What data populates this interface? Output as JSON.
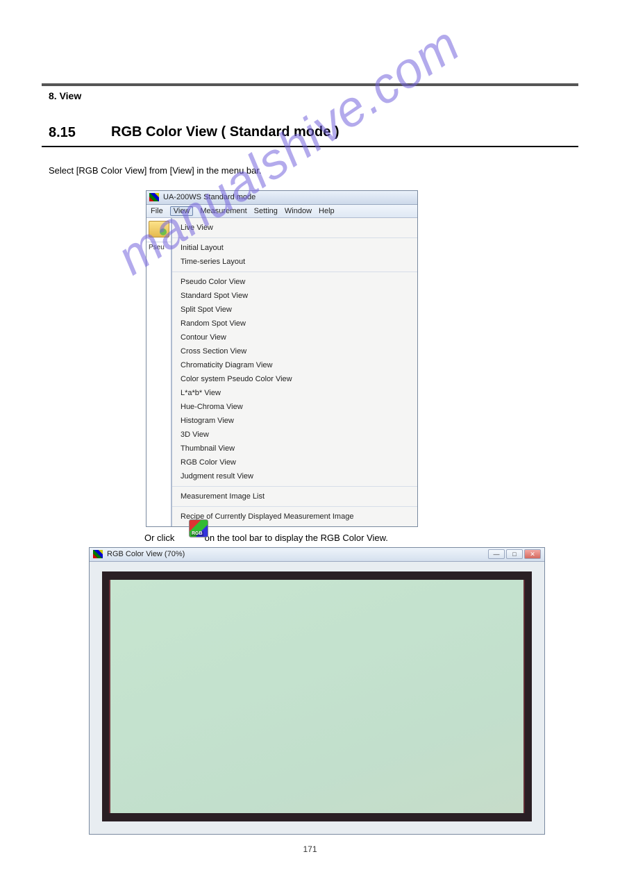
{
  "page_header": "8. View",
  "section_number": "8.15",
  "section_title": "RGB Color View ( Standard mode )",
  "body_paragraph": "Select [RGB Color View] from [View] in the menu bar.",
  "win1": {
    "title": "UA-200WS Standard mode",
    "menubar": [
      "File",
      "View",
      "Measurement",
      "Setting",
      "Window",
      "Help"
    ],
    "active_menu_index": 1,
    "sidebar_tab": "Pseu",
    "dropdown_sections": [
      [
        "Live View"
      ],
      [
        "Initial Layout",
        "Time-series Layout"
      ],
      [
        "Pseudo Color View",
        "Standard Spot View",
        "Split Spot View",
        "Random Spot View",
        "Contour View",
        "Cross Section View",
        "Chromaticity Diagram View",
        "Color system Pseudo Color View",
        "L*a*b* View",
        "Hue-Chroma View",
        "Histogram View",
        "3D View",
        "Thumbnail View",
        "RGB Color View",
        "Judgment result View"
      ],
      [
        "Measurement Image List"
      ],
      [
        "Recipe of Currently Displayed Measurement Image"
      ]
    ]
  },
  "toolbar_note": "Or click            on the tool bar to display the RGB Color View.",
  "win2": {
    "title": "RGB Color View (70%)",
    "buttons": {
      "min": "—",
      "max": "□",
      "close": "✕"
    }
  },
  "watermark": "manualshive.com",
  "footer_page": "171"
}
